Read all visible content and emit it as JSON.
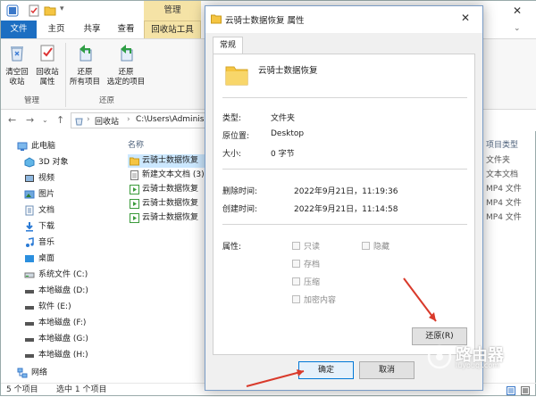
{
  "titlebar": {
    "context_tab": "管理",
    "minimize": "—",
    "maximize": "☐",
    "close": "✕"
  },
  "ribbon_tabs": [
    {
      "label": "文件"
    },
    {
      "label": "主页"
    },
    {
      "label": "共享"
    },
    {
      "label": "查看"
    },
    {
      "label": "回收站工具"
    }
  ],
  "ribbon": {
    "empty_bin_l1": "清空回",
    "empty_bin_l2": "收站",
    "bin_props_l1": "回收站",
    "bin_props_l2": "属性",
    "restore_all_l1": "还原",
    "restore_all_l2": "所有项目",
    "restore_sel_l1": "还原",
    "restore_sel_l2": "选定的项目",
    "group_manage": "管理",
    "group_restore": "还原"
  },
  "address": {
    "segment1": "回收站",
    "segment2": "C:\\Users\\Adminis"
  },
  "nav_pane": [
    {
      "label": "此电脑",
      "icon": "pc-icon"
    },
    {
      "label": "3D 对象",
      "icon": "3d-objects-icon"
    },
    {
      "label": "视频",
      "icon": "video-icon"
    },
    {
      "label": "图片",
      "icon": "pictures-icon"
    },
    {
      "label": "文档",
      "icon": "documents-icon"
    },
    {
      "label": "下载",
      "icon": "download-icon"
    },
    {
      "label": "音乐",
      "icon": "music-icon"
    },
    {
      "label": "桌面",
      "icon": "desktop-icon"
    },
    {
      "label": "系统文件 (C:)",
      "icon": "drive-icon"
    },
    {
      "label": "本地磁盘 (D:)",
      "icon": "drive-icon"
    },
    {
      "label": "软件 (E:)",
      "icon": "drive-icon"
    },
    {
      "label": "本地磁盘 (F:)",
      "icon": "drive-icon"
    },
    {
      "label": "本地磁盘 (G:)",
      "icon": "drive-icon"
    },
    {
      "label": "本地磁盘 (H:)",
      "icon": "drive-icon"
    },
    {
      "label": "网络",
      "icon": "network-icon"
    }
  ],
  "file_list": {
    "col_name": "名称",
    "col_type": "项目类型",
    "rows": [
      {
        "name": "云骑士数据恢复",
        "type": "文件夹",
        "icon": "folder-icon",
        "selected": true
      },
      {
        "name": "新建文本文档 (3)",
        "type": "文本文档",
        "icon": "text-file-icon"
      },
      {
        "name": "云骑士数据恢复",
        "type": "MP4 文件",
        "icon": "video-file-icon"
      },
      {
        "name": "云骑士数据恢复",
        "type": "MP4 文件",
        "icon": "video-file-icon"
      },
      {
        "name": "云骑士数据恢复",
        "type": "MP4 文件",
        "icon": "video-file-icon"
      }
    ]
  },
  "status": {
    "count": "5 个项目",
    "selected": "选中 1 个项目"
  },
  "dialog": {
    "title": "云骑士数据恢复 属性",
    "close": "✕",
    "tab": "常规",
    "name": "云骑士数据恢复",
    "type_label": "类型:",
    "type_value": "文件夹",
    "origin_label": "原位置:",
    "origin_value": "Desktop",
    "size_label": "大小:",
    "size_value": "0 字节",
    "deleted_label": "删除时间:",
    "deleted_value": "2022年9月21日，11:19:36",
    "created_label": "创建时间:",
    "created_value": "2022年9月21日，11:14:58",
    "attr_label": "属性:",
    "attr_readonly": "只读",
    "attr_hidden": "隐藏",
    "attr_archive": "存档",
    "attr_compress": "压缩",
    "attr_encrypt": "加密内容",
    "restore_button": "还原(R)",
    "ok_button": "确定",
    "cancel_button": "取消"
  },
  "watermark": {
    "text": "路由器",
    "url": "luyouqi.com"
  },
  "colors": {
    "accent": "#1c6ec2",
    "arrow": "#d93a2b",
    "selection": "#cce8ff"
  }
}
